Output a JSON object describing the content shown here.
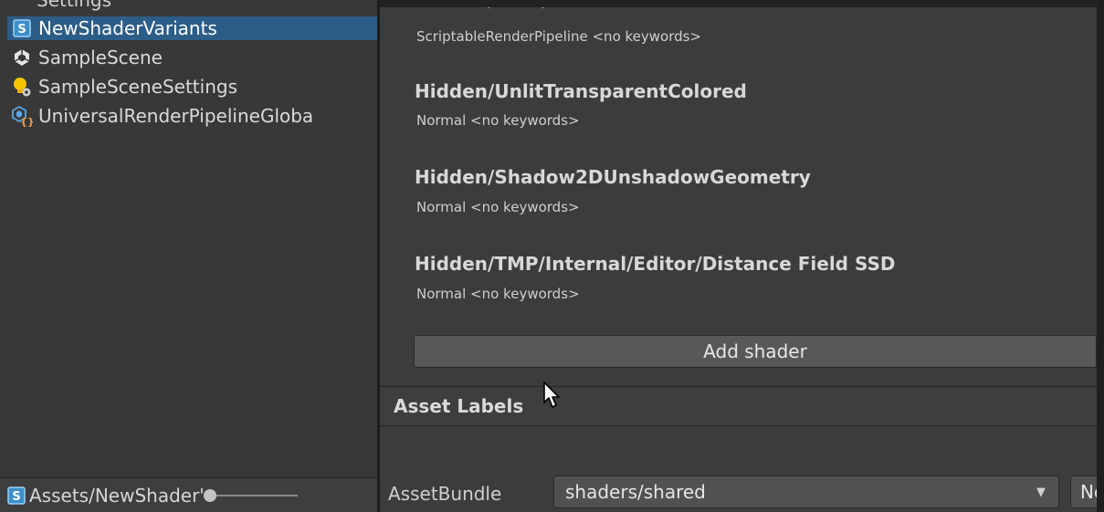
{
  "project": {
    "cut_off_item": "Settings",
    "items": [
      {
        "label": "NewShaderVariants",
        "icon": "shader-variants-icon",
        "selected": true
      },
      {
        "label": "SampleScene",
        "icon": "unity-scene-icon",
        "selected": false
      },
      {
        "label": "SampleSceneSettings",
        "icon": "lighting-settings-icon",
        "selected": false
      },
      {
        "label": "UniversalRenderPipelineGloba",
        "icon": "render-pipeline-asset-icon",
        "selected": false
      }
    ],
    "footer_path": "Assets/NewShader'",
    "zoom_slider_icon": "zoom-slider"
  },
  "inspector": {
    "cut_off_title": "Hidden/Core/LensFlareDataDrivenPreview",
    "shaders": [
      {
        "title": "",
        "subtitle": "ScriptableRenderPipeline <no keywords>"
      },
      {
        "title": "Hidden/UnlitTransparentColored",
        "subtitle": "Normal <no keywords>"
      },
      {
        "title": "Hidden/Shadow2DUnshadowGeometry",
        "subtitle": "Normal <no keywords>"
      },
      {
        "title": "Hidden/TMP/Internal/Editor/Distance Field SSD",
        "subtitle": "Normal <no keywords>"
      }
    ],
    "add_shader_label": "Add shader",
    "asset_labels_header": "Asset Labels",
    "asset_bundle": {
      "label": "AssetBundle",
      "value": "shaders/shared",
      "variant_value": "No"
    }
  },
  "colors": {
    "selection": "#2c5d87",
    "panel_bg": "#383838",
    "inspector_bg": "#3c3c3c",
    "button_bg": "#585858"
  }
}
